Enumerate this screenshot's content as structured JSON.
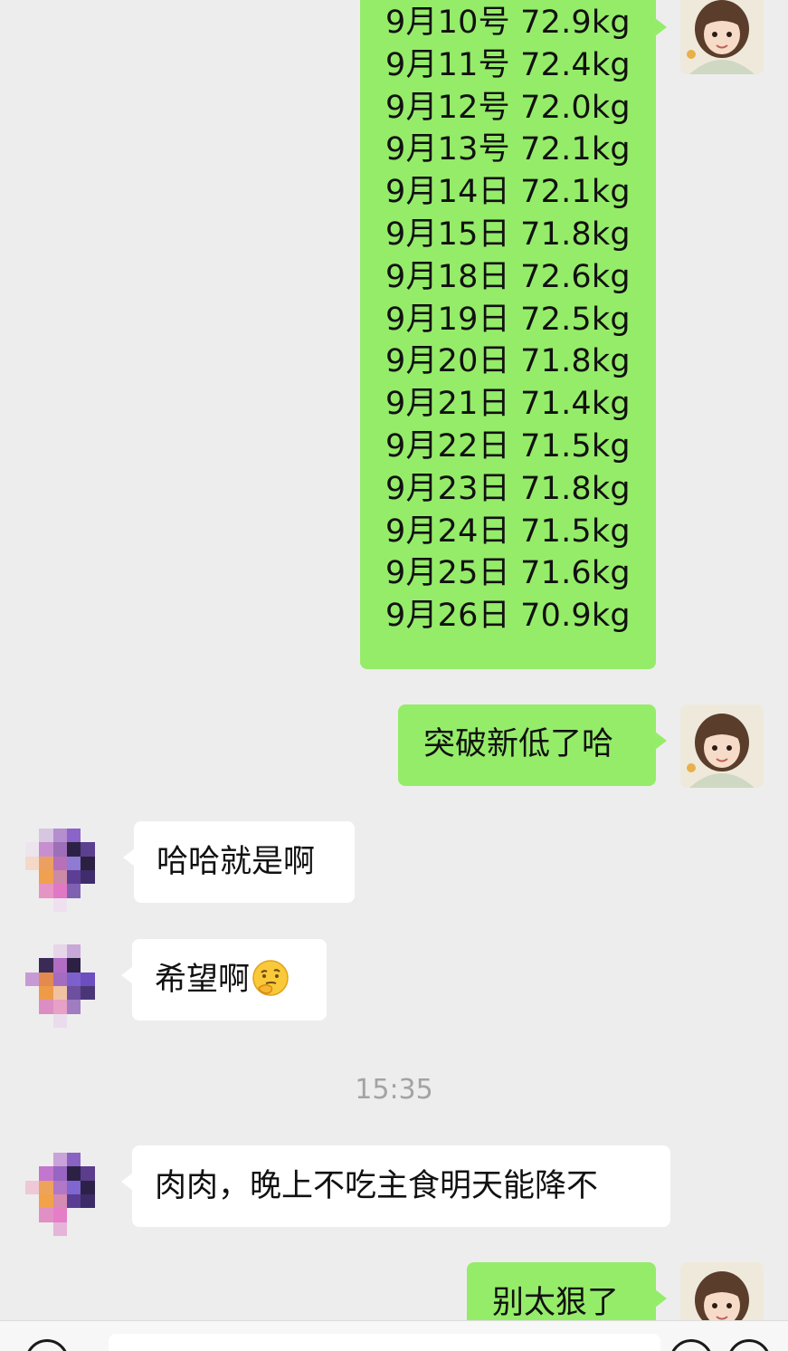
{
  "weights_message": {
    "lines": [
      "9月10号 72.9kg",
      "9月11号 72.4kg",
      "9月12号 72.0kg",
      "9月13号 72.1kg",
      "9月14日 72.1kg",
      "9月15日 71.8kg",
      "9月18日 72.6kg",
      "9月19日 72.5kg",
      "9月20日 71.8kg",
      "9月21日 71.4kg",
      "9月22日 71.5kg",
      "9月23日 71.8kg",
      "9月24日 71.5kg",
      "9月25日 71.6kg",
      "9月26日 70.9kg"
    ]
  },
  "messages": {
    "m1": "突破新低了哈",
    "m2": "哈哈就是啊",
    "m3": "希望啊",
    "m3_emoji": "thinking-face-emoji",
    "m4": "肉肉，晚上不吃主食明天能降不",
    "m5": "别太狠了"
  },
  "timestamp": "15:35",
  "colors": {
    "outgoing_bubble": "#95ec69",
    "incoming_bubble": "#ffffff",
    "background": "#ededed"
  }
}
